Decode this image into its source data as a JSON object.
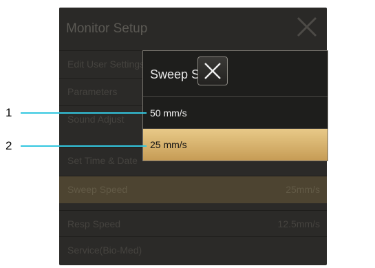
{
  "background_dialog": {
    "title": "Monitor Setup",
    "items": [
      {
        "label": "Edit User Settings",
        "value": ""
      },
      {
        "label": "Parameters",
        "value": ""
      },
      {
        "label": "Sound Adjust",
        "value": ""
      },
      {
        "label": "Set Time & Date",
        "value": ""
      },
      {
        "label": "Sweep Speed",
        "value": "25mm/s",
        "selected": true
      },
      {
        "label": "Resp Speed",
        "value": "12.5mm/s"
      },
      {
        "label": "Service(Bio-Med)",
        "value": ""
      }
    ]
  },
  "popup": {
    "title": "Sweep Speed",
    "options": [
      {
        "label": "50 mm/s",
        "selected": false
      },
      {
        "label": "25 mm/s",
        "selected": true
      }
    ]
  },
  "callouts": [
    {
      "number": "1"
    },
    {
      "number": "2"
    }
  ],
  "colors": {
    "selected_gradient_top": "#e8c988",
    "selected_gradient_bottom": "#c69c55",
    "callout_line": "#33c7e0"
  }
}
